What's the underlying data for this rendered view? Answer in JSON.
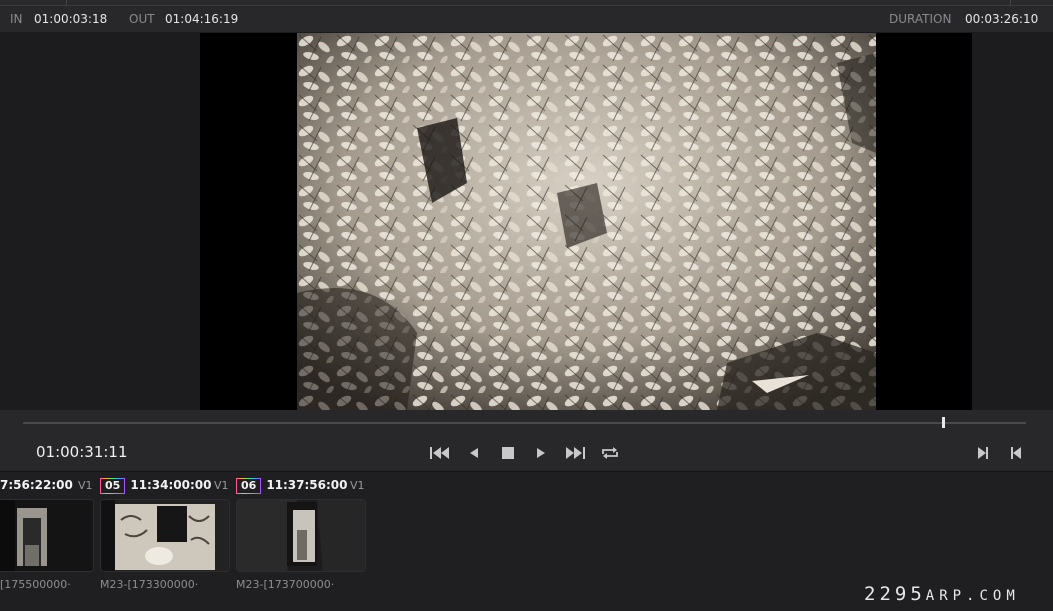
{
  "header": {
    "in_label": "IN",
    "in_value": "01:00:03:18",
    "out_label": "OUT",
    "out_value": "01:04:16:19",
    "duration_label": "DURATION",
    "duration_value": "00:03:26:10"
  },
  "viewer": {
    "current_timecode": "01:00:31:11",
    "scrub_position": 0.917
  },
  "transport": {
    "buttons": [
      "jump-to-start",
      "step-back",
      "stop",
      "play",
      "jump-to-end",
      "loop",
      "next-edit",
      "previous-edit"
    ]
  },
  "clips": [
    {
      "num": "",
      "timecode": "7:56:22:00",
      "track": "V1",
      "name": "[175500000·"
    },
    {
      "num": "05",
      "timecode": "11:34:00:00",
      "track": "V1",
      "name": "M23-[173300000·"
    },
    {
      "num": "06",
      "timecode": "11:37:56:00",
      "track": "V1",
      "name": "M23-[173700000·"
    }
  ],
  "watermark": {
    "main": "2295",
    "suffix": "ARP.COM"
  },
  "colors": {
    "panel": "#28282b",
    "background": "#1e1e20",
    "text": "#e6e6e6",
    "muted": "#8a8a8e"
  }
}
